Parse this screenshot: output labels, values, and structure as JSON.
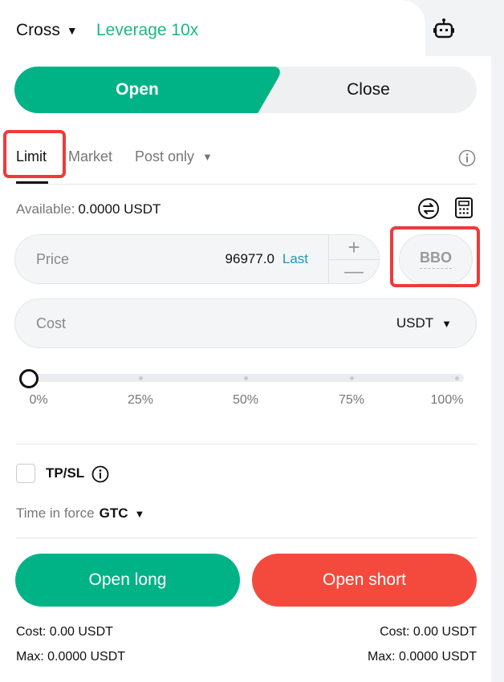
{
  "header": {
    "margin_mode": "Cross",
    "leverage": "Leverage 10x"
  },
  "mode_tabs": {
    "open_label": "Open",
    "close_label": "Close"
  },
  "order_types": {
    "limit": "Limit",
    "market": "Market",
    "post_only": "Post only"
  },
  "available": {
    "label": "Available:",
    "value": "0.0000 USDT"
  },
  "price": {
    "label": "Price",
    "value": "96977.0",
    "last_label": "Last",
    "plus": "+",
    "minus": "—"
  },
  "bbo": {
    "label": "BBO"
  },
  "cost": {
    "label": "Cost",
    "unit": "USDT"
  },
  "slider": {
    "value_percent": 0,
    "ticks": [
      "0%",
      "25%",
      "50%",
      "75%",
      "100%"
    ]
  },
  "tpsl": {
    "label": "TP/SL",
    "checked": false
  },
  "time_in_force": {
    "label": "Time in force",
    "value": "GTC"
  },
  "actions": {
    "open_long": "Open long",
    "open_short": "Open short"
  },
  "summary": {
    "long_cost": "Cost: 0.00 USDT",
    "long_max": "Max: 0.0000 USDT",
    "short_cost": "Cost: 0.00 USDT",
    "short_max": "Max: 0.0000 USDT"
  },
  "colors": {
    "accent_green": "#00b386",
    "accent_red": "#f44a3e",
    "highlight": "#ef3a3a",
    "link_blue": "#1a9ab9"
  }
}
